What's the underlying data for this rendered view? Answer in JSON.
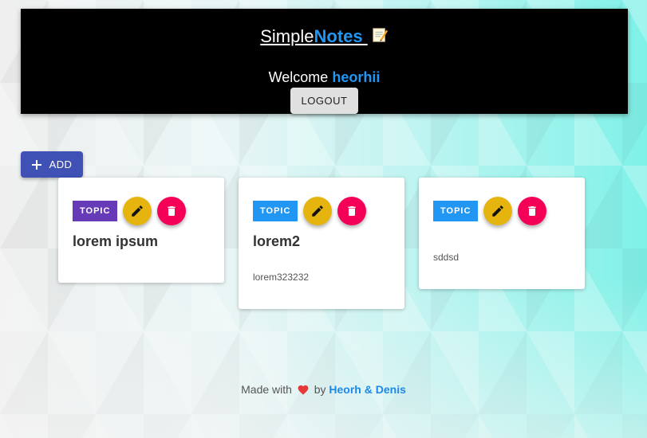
{
  "header": {
    "brand_part1": "Simple",
    "brand_part2": "Notes",
    "brand_icon": "memo-icon",
    "welcome_text": "Welcome",
    "username": "heorhii",
    "logout_label": "LOGOUT"
  },
  "toolbar": {
    "add_label": "ADD",
    "add_icon": "plus-icon"
  },
  "notes": [
    {
      "topic": "TOPIC",
      "topic_color": "#673ab7",
      "title": "lorem ipsum",
      "body": ""
    },
    {
      "topic": "TOPIC",
      "topic_color": "#2196f3",
      "title": "lorem2",
      "body": "lorem323232"
    },
    {
      "topic": "TOPIC",
      "topic_color": "#2196f3",
      "title": "",
      "body": "sddsd"
    }
  ],
  "footer": {
    "made_with": "Made with",
    "by": "by",
    "authors": "Heorh & Denis",
    "heart_icon": "heart-icon"
  },
  "colors": {
    "header_bg": "#000000",
    "accent_blue": "#2196f3",
    "add_button": "#3f51b5",
    "edit_button": "#e6b40e",
    "delete_button": "#f50057"
  }
}
